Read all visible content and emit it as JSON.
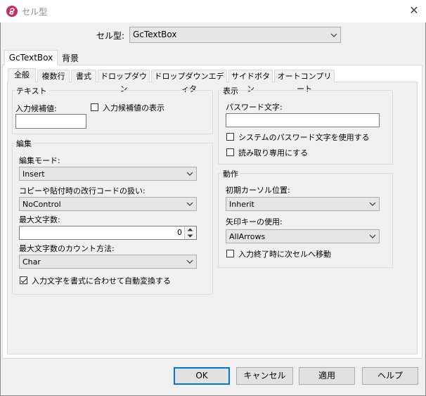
{
  "window": {
    "title": "セル型",
    "close_glyph": "✕"
  },
  "cell_type": {
    "label": "セル型:",
    "value": "GcTextBox"
  },
  "outer_tabs": [
    {
      "label": "GcTextBox"
    },
    {
      "label": "背景"
    }
  ],
  "inner_tabs": [
    {
      "label": "全般"
    },
    {
      "label": "複数行"
    },
    {
      "label": "書式"
    },
    {
      "label": "ドロップダウン"
    },
    {
      "label": "ドロップダウンエディタ"
    },
    {
      "label": "サイドボタン"
    },
    {
      "label": "オートコンプリート"
    }
  ],
  "text_group": {
    "title": "テキスト",
    "candidate_label": "入力候補値:",
    "candidate_value": "",
    "show_candidates_label": "入力候補値の表示"
  },
  "edit_group": {
    "title": "編集",
    "edit_mode_label": "編集モード:",
    "edit_mode_value": "Insert",
    "crlf_label": "コピーや貼付時の改行コードの扱い:",
    "crlf_value": "NoControl",
    "maxlen_label": "最大文字数:",
    "maxlen_value": "0",
    "count_label": "最大文字数のカウント方法:",
    "count_value": "Char",
    "autoconvert_label": "入力文字を書式に合わせて自動変換する"
  },
  "display_group": {
    "title": "表示",
    "password_label": "パスワード文字:",
    "password_value": "",
    "system_password_label": "システムのパスワード文字を使用する",
    "readonly_label": "読み取り専用にする"
  },
  "action_group": {
    "title": "動作",
    "cursor_label": "初期カーソル位置:",
    "cursor_value": "Inherit",
    "arrow_label": "矢印キーの使用:",
    "arrow_value": "AllArrows",
    "next_cell_label": "入力終了時に次セルへ移動"
  },
  "buttons": {
    "ok": "OK",
    "cancel": "キャンセル",
    "apply": "適用",
    "help": "ヘルプ"
  }
}
